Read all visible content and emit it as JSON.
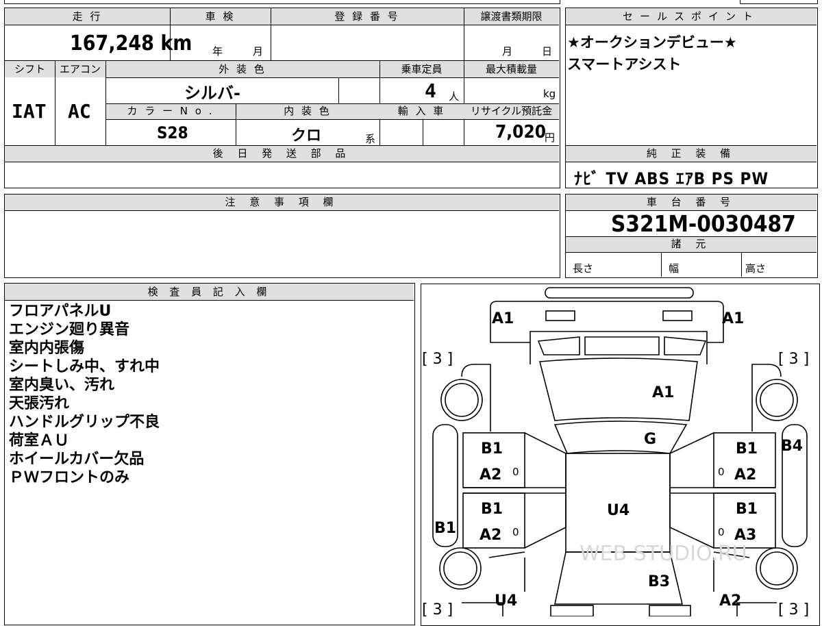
{
  "row1": {
    "mileage_label": "走 行",
    "mileage_value": "167,248 km",
    "shaken_label": "車 検",
    "shaken_year": "年",
    "shaken_month": "月",
    "reg_label": "登 録 番 号",
    "transfer_label": "譲渡書類期限",
    "transfer_month": "月",
    "transfer_day": "日"
  },
  "row2": {
    "shift_label": "シフト",
    "shift_value": "IAT",
    "ac_label": "エアコン",
    "ac_value": "AC",
    "exterior_label": "外 装 色",
    "exterior_value": "シルバ-",
    "capacity_label": "乗車定員",
    "capacity_value": "4",
    "capacity_unit": "人",
    "load_label": "最大積載量",
    "load_unit": "kg",
    "color_no_label": "カ ラ ー N o .",
    "color_no_value": "S28",
    "interior_label": "内 装 色",
    "interior_value": "クロ",
    "interior_suffix": "系",
    "import_label": "輸 入 車",
    "recycle_label": "リサイクル預託金",
    "recycle_value": "7,020",
    "recycle_unit": "円"
  },
  "later_parts_label": "後 日 発 送 部 品",
  "sales": {
    "label": "セールスポイント",
    "lines": [
      "★オークションデビュー★",
      "スマートアシスト"
    ]
  },
  "equipment": {
    "label": "純 正 装 備",
    "value": "ﾅﾋﾞ TV ABS ｴｱB PS PW"
  },
  "caution_label": "注 意 事 項 欄",
  "chassis": {
    "label": "車 台 番 号",
    "value": "S321M-0030487"
  },
  "specs": {
    "label": "諸 元",
    "length": "長さ",
    "width": "幅",
    "height": "高さ"
  },
  "inspector": {
    "label": "検 査 員 記 入 欄",
    "notes": [
      "フロアパネルU",
      "エンジン廻り異音",
      "室内内張傷",
      "シートしみ中、すれ中",
      "室内臭い、汚れ",
      "天張汚れ",
      "ハンドルグリップ不良",
      "荷室ＡＵ",
      "ホイールカバー欠品",
      "ＰＷフロントのみ"
    ]
  },
  "diagram": {
    "tire_marks": [
      "[ 3 ]",
      "[ 3 ]",
      "[ 3 ]",
      "[ 3 ]"
    ],
    "front_left": "A1",
    "front_right": "A1",
    "windshield": "A1",
    "hood": "G",
    "left_front_door_top": "B1",
    "left_front_door_bottom": "A2",
    "left_rear_door_top": "B1",
    "left_rear_door_bottom": "A2",
    "right_front_door_top": "B1",
    "right_front_door_bottom": "A2",
    "right_rear_door_top": "B1",
    "right_rear_door_bottom": "A3",
    "right_side": "B4",
    "left_side": "B1",
    "roof": "U4",
    "rear_glass": "B3",
    "rear_left": "U4",
    "rear_right": "A2",
    "zero_marks": [
      "0",
      "0",
      "0",
      "0"
    ],
    "watermark": "WEB STUDIO.RU"
  }
}
